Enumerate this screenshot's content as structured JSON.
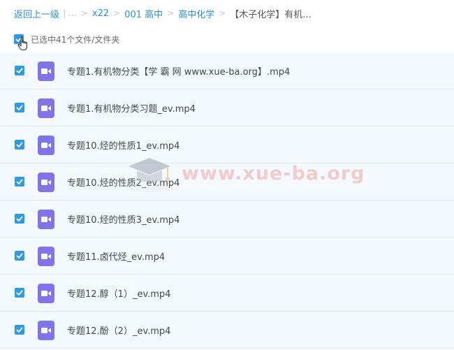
{
  "breadcrumb": {
    "back": "返回上一级",
    "ellipsis": "...",
    "separator": ">",
    "items": [
      "x22",
      "001 高中",
      "高中化学"
    ],
    "current": "【木子化学】有机..."
  },
  "selection": {
    "status": "已选中41个文件/文件夹"
  },
  "files": [
    {
      "name": "专题1.有机物分类【学 霸 网 www.xue-ba.org】.mp4",
      "checked": true
    },
    {
      "name": "专题1.有机物分类习题_ev.mp4",
      "checked": true
    },
    {
      "name": "专题10.烃的性质1_ev.mp4",
      "checked": true
    },
    {
      "name": "专题10.烃的性质2_ev.mp4",
      "checked": true
    },
    {
      "name": "专题10.烃的性质3_ev.mp4",
      "checked": true
    },
    {
      "name": "专题11.卤代烃_ev.mp4",
      "checked": true
    },
    {
      "name": "专题12.醇（1）_ev.mp4",
      "checked": true
    },
    {
      "name": "专题12.酚（2）_ev.mp4",
      "checked": true
    }
  ],
  "watermark": {
    "text": "www.xue-ba.org",
    "icon": "graduation-cap-icon"
  },
  "colors": {
    "link": "#2a8fd6",
    "checkbox": "#2e9ae6",
    "video_icon": "#7f74ea",
    "row_background": "#f4f9fe",
    "watermark": "#f2a7a2"
  }
}
